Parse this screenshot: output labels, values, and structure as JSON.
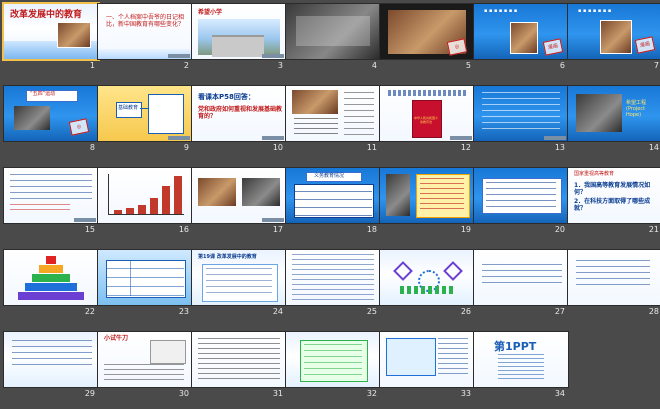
{
  "slides": [
    {
      "id": 1,
      "number": "1",
      "text": [
        "改革发展中的教育"
      ]
    },
    {
      "id": 2,
      "number": "2",
      "text": [
        "一、个人档案中吾爷的日记相比，新中国教育有哪些变化？"
      ]
    },
    {
      "id": 3,
      "number": "3",
      "text": [
        "希望小学"
      ]
    },
    {
      "id": 4,
      "number": "4",
      "text": []
    },
    {
      "id": 5,
      "number": "5",
      "text": []
    },
    {
      "id": 6,
      "number": "6",
      "text": [
        "漫画"
      ]
    },
    {
      "id": 7,
      "number": "7",
      "text": [
        "漫画"
      ]
    },
    {
      "id": 8,
      "number": "8",
      "text": [
        "“五四”运动"
      ]
    },
    {
      "id": 9,
      "number": "9",
      "text": [
        "基础教育"
      ]
    },
    {
      "id": 10,
      "number": "10",
      "text": [
        "看课本P58回答：",
        "党和政府如何重视和发展基础教育的？"
      ]
    },
    {
      "id": 11,
      "number": "11",
      "text": []
    },
    {
      "id": 12,
      "number": "12",
      "text": [
        "中华人民共和国义务教育法"
      ]
    },
    {
      "id": 13,
      "number": "13",
      "text": []
    },
    {
      "id": 14,
      "number": "14",
      "text": [
        "希望工程 (Project Hope)"
      ]
    },
    {
      "id": 15,
      "number": "15",
      "text": []
    },
    {
      "id": 16,
      "number": "16",
      "text": []
    },
    {
      "id": 17,
      "number": "17",
      "text": []
    },
    {
      "id": 18,
      "number": "18",
      "text": [
        "义务教育情况"
      ]
    },
    {
      "id": 19,
      "number": "19",
      "text": []
    },
    {
      "id": 20,
      "number": "20",
      "text": []
    },
    {
      "id": 21,
      "number": "21",
      "text": [
        "国家重视高等教育",
        "1．我国高等教育发展情况如何？",
        "2．在科技方面取得了哪些成就？"
      ]
    },
    {
      "id": 22,
      "number": "22",
      "text": []
    },
    {
      "id": 23,
      "number": "23",
      "text": []
    },
    {
      "id": 24,
      "number": "24",
      "text": [
        "第19课 改革发展中的教育"
      ]
    },
    {
      "id": 25,
      "number": "25",
      "text": []
    },
    {
      "id": 26,
      "number": "26",
      "text": []
    },
    {
      "id": 27,
      "number": "27",
      "text": []
    },
    {
      "id": 28,
      "number": "28",
      "text": []
    },
    {
      "id": 29,
      "number": "29",
      "text": []
    },
    {
      "id": 30,
      "number": "30",
      "text": [
        "小试牛刀"
      ]
    },
    {
      "id": 31,
      "number": "31",
      "text": []
    },
    {
      "id": 32,
      "number": "32",
      "text": []
    },
    {
      "id": 33,
      "number": "33",
      "text": []
    },
    {
      "id": 34,
      "number": "34",
      "text": [
        "第1PPT"
      ]
    }
  ],
  "colors": {
    "bg": "#4a4a4a",
    "blue_theme": "#1877d6",
    "title_red": "#c21a1a",
    "text_blue": "#0b3d91",
    "selection": "#f2c14e"
  }
}
